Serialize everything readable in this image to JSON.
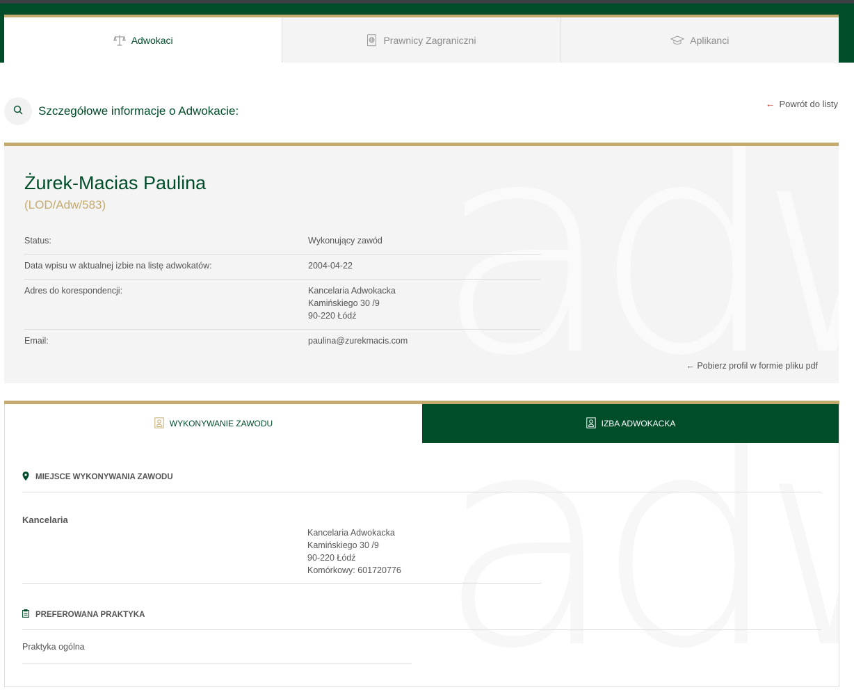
{
  "tabs": [
    {
      "label": "Adwokaci",
      "icon": "scales-icon",
      "active": true
    },
    {
      "label": "Prawnicy Zagraniczni",
      "icon": "globe-document-icon",
      "active": false
    },
    {
      "label": "Aplikanci",
      "icon": "graduation-cap-icon",
      "active": false
    }
  ],
  "header": {
    "title": "Szczegółowe informacje o Adwokacie:",
    "back_label": "Powrót do listy"
  },
  "profile": {
    "name": "Żurek-Macias Paulina",
    "registration": "(LOD/Adw/583)",
    "rows": [
      {
        "label": "Status:",
        "value": "Wykonujący zawód"
      },
      {
        "label": "Data wpisu w aktualnej izbie na listę adwokatów:",
        "value": "2004-04-22"
      },
      {
        "label": "Adres do korespondencji:",
        "value_lines": [
          "Kancelaria Adwokacka",
          "Kamińskiego 30 /9",
          "90-220 Łódź"
        ]
      },
      {
        "label": "Email:",
        "value": "paulina@zurekmacis.com"
      }
    ],
    "pdf_label": "Pobierz profil w formie pliku pdf",
    "watermark": "adwp"
  },
  "panel": {
    "tabs": [
      {
        "label": "WYKONYWANIE ZAWODU",
        "active": true
      },
      {
        "label": "IZBA ADWOKACKA",
        "active": false
      }
    ],
    "place_heading": "MIEJSCE WYKONYWANIA ZAWODU",
    "office_type": "Kancelaria",
    "office_lines": [
      "Kancelaria Adwokacka",
      "Kamińskiego 30 /9",
      "90-220 Łódź",
      "Komórkowy: 601720776"
    ],
    "practice_heading": "PREFEROWANA PRAKTYKA",
    "practice": "Praktyka ogólna"
  },
  "colors": {
    "brand_green": "#004d2a",
    "gold": "#c4aa6e",
    "back_arrow": "#c0392b"
  }
}
